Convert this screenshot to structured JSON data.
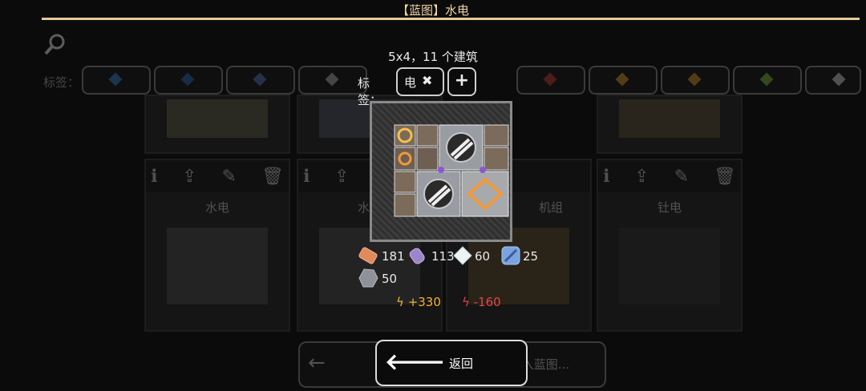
{
  "header": {
    "title": "【蓝图】水电"
  },
  "background": {
    "tags_label": "标签：",
    "cards": [
      {
        "label": "水电"
      },
      {
        "label": "水电"
      },
      {
        "label": "机组"
      },
      {
        "label": "钍电"
      }
    ],
    "bottom_button_label": "入蓝图..."
  },
  "popup": {
    "size_info": "5x4，11 个建筑",
    "tags_label": "标签：",
    "tag_chip_label": "电",
    "resources": [
      {
        "name": "copper-ingot",
        "value": "181",
        "color": "#e38a5c"
      },
      {
        "name": "lilac-crystal",
        "value": "113",
        "color": "#9b86c9"
      },
      {
        "name": "white-crystal",
        "value": "60",
        "color": "#eef2f5"
      },
      {
        "name": "blue-plate",
        "value": "25",
        "color": "#7aa3e0"
      },
      {
        "name": "grey-ore",
        "value": "50",
        "color": "#8e9298"
      }
    ],
    "energy_plus": "+330",
    "energy_minus": "-160",
    "colors": {
      "energy_plus": "#f1b23a",
      "energy_minus": "#e2444a"
    }
  },
  "footer": {
    "back_label": "返回"
  }
}
